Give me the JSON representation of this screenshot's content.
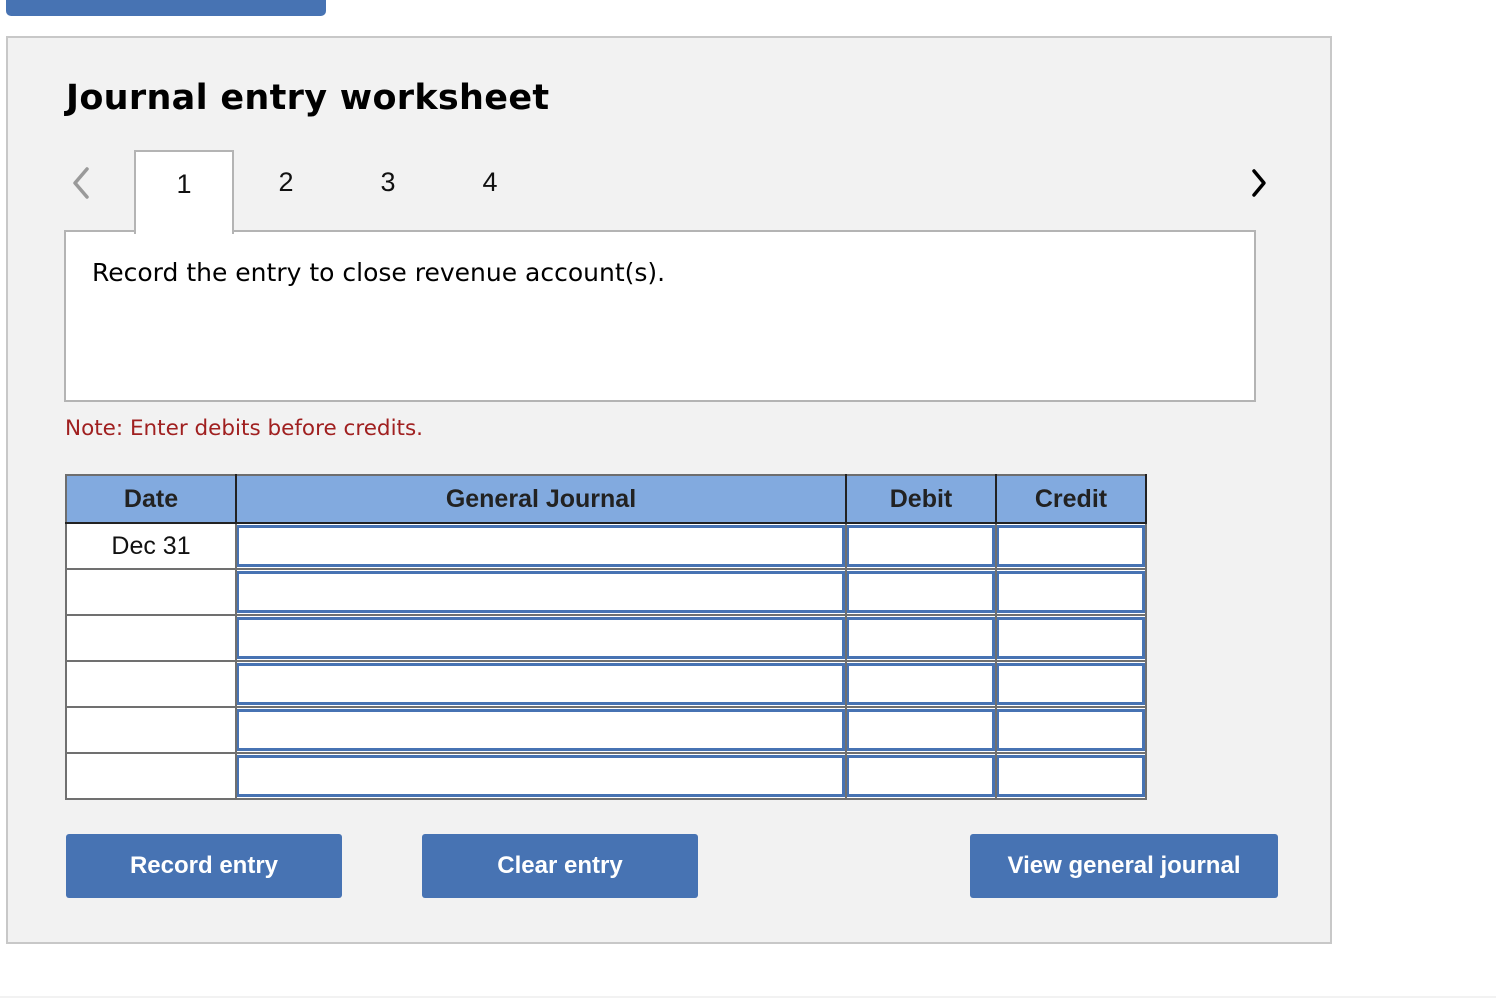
{
  "header": {
    "top_tab_color": "#4773b3"
  },
  "worksheet": {
    "title": "Journal entry worksheet",
    "nav": {
      "prev_icon": "chevron-left-icon",
      "next_icon": "chevron-right-icon"
    },
    "tabs": [
      {
        "label": "1",
        "active": true
      },
      {
        "label": "2",
        "active": false
      },
      {
        "label": "3",
        "active": false
      },
      {
        "label": "4",
        "active": false
      }
    ],
    "instruction": "Record the entry to close revenue account(s).",
    "note": "Note: Enter debits before credits.",
    "table": {
      "headers": {
        "date": "Date",
        "account": "General Journal",
        "debit": "Debit",
        "credit": "Credit"
      },
      "rows": [
        {
          "date": "Dec 31",
          "account": "",
          "debit": "",
          "credit": ""
        },
        {
          "date": "",
          "account": "",
          "debit": "",
          "credit": ""
        },
        {
          "date": "",
          "account": "",
          "debit": "",
          "credit": ""
        },
        {
          "date": "",
          "account": "",
          "debit": "",
          "credit": ""
        },
        {
          "date": "",
          "account": "",
          "debit": "",
          "credit": ""
        },
        {
          "date": "",
          "account": "",
          "debit": "",
          "credit": ""
        }
      ]
    },
    "buttons": {
      "record": "Record entry",
      "clear": "Clear entry",
      "view": "View general journal"
    }
  },
  "colors": {
    "accent": "#4773b3",
    "header_bg": "#82aadf",
    "note": "#a02020",
    "panel_bg": "#f2f2f2"
  }
}
